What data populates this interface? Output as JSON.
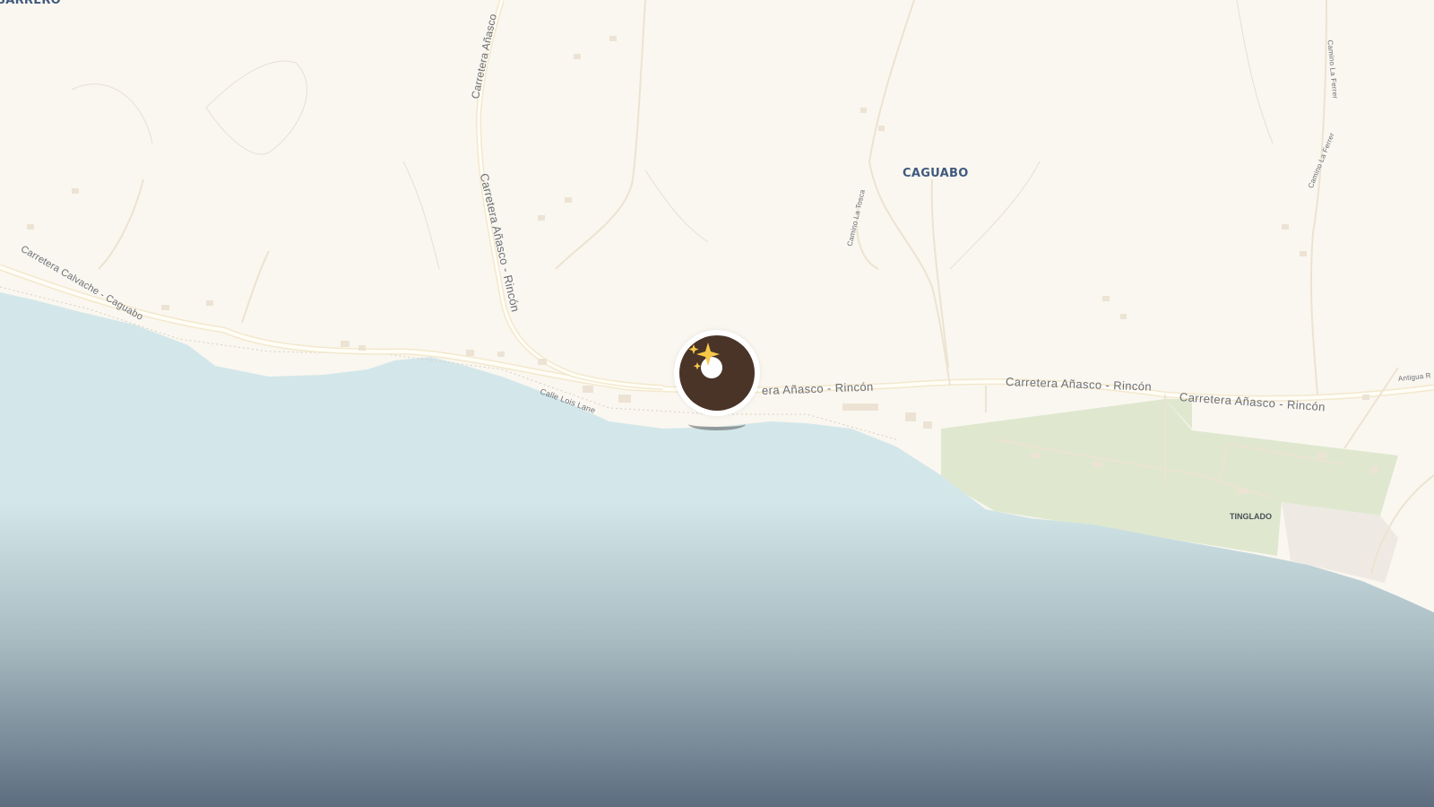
{
  "map": {
    "places": {
      "caguabo": "CAGUABO",
      "barrero": "BARRERO",
      "tinglado": "TINGLADO"
    },
    "roads": {
      "anasco_rincon_vertical": "Carretera Añasco - Rincón",
      "anasco_rincon_top": "Carretera Añasco",
      "anasco_rincon_east_1": "Carretera Añasco - Rincón",
      "anasco_rincon_east_2": "Carretera Añasco - Rincón",
      "anasco_rincon_near_marker": "era Añasco - Rincón",
      "calvache_caguabo": "Carretera Calvache - Caguabo",
      "lois_lane": "Calle Lois Lane",
      "la_tosca": "Camino La Tosca",
      "la_ferrer_1": "Camino La Ferrer",
      "la_ferrer_2": "Camino La Ferrer",
      "antigua": "Antigua R"
    },
    "colors": {
      "land": "#faf7f0",
      "water": "#d3e7ea",
      "water_deep": "#5d6d80",
      "park": "#dfe8cf",
      "road": "#fdf6e4",
      "marker_ring": "#4a3428"
    },
    "marker_icon": "sparkles-icon"
  }
}
